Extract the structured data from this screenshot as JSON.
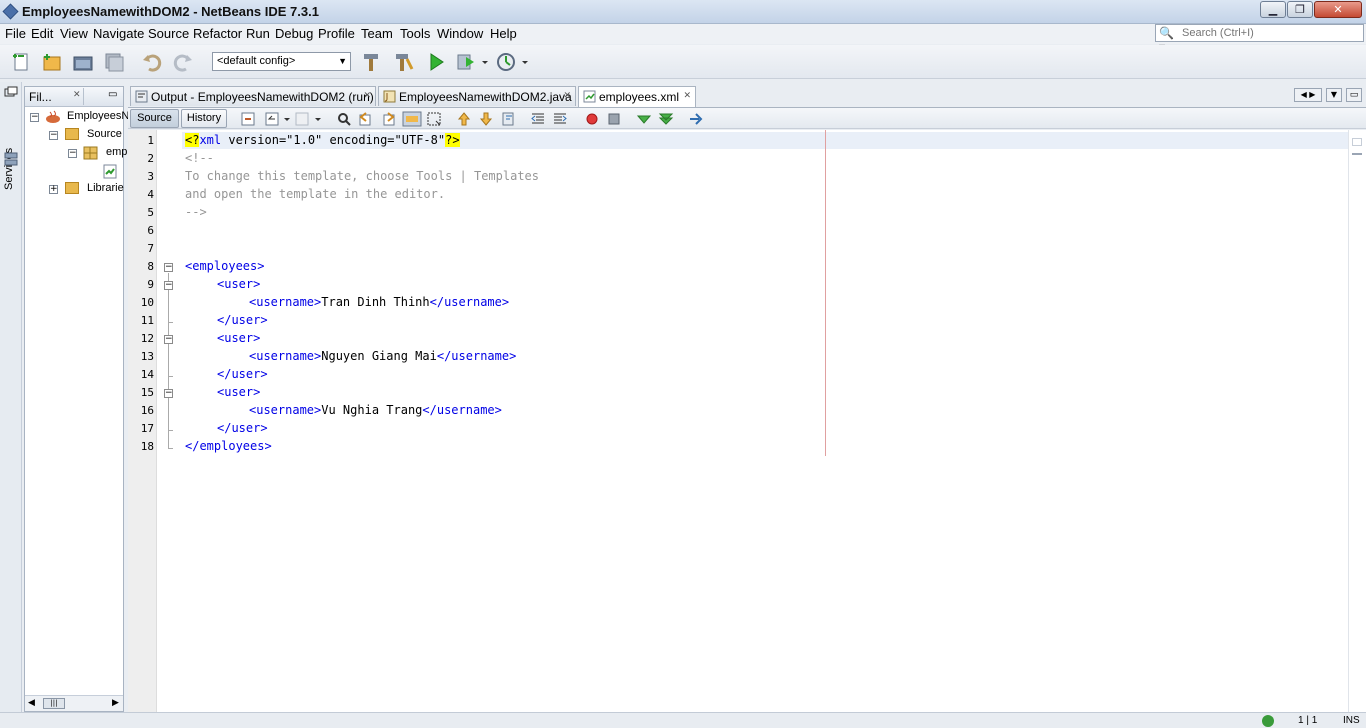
{
  "window": {
    "title": "EmployeesNamewithDOM2 - NetBeans IDE 7.3.1",
    "min_label": "▁",
    "max_label": "❐",
    "close_label": "✕"
  },
  "menubar": {
    "items": [
      "File",
      "Edit",
      "View",
      "Navigate",
      "Source",
      "Refactor",
      "Run",
      "Debug",
      "Profile",
      "Team",
      "Tools",
      "Window",
      "Help"
    ]
  },
  "search": {
    "placeholder": "Search (Ctrl+I)"
  },
  "toolbar": {
    "config": "<default config>"
  },
  "side_strip": {
    "services_label": "Services"
  },
  "files_panel": {
    "title": "Fil...",
    "tree": [
      {
        "label": "EmployeesN",
        "level": 0
      },
      {
        "label": "Source",
        "level": 1
      },
      {
        "label": "emp",
        "level": 2
      },
      {
        "label": "Librarie",
        "level": 1
      }
    ]
  },
  "editor_tabs": [
    {
      "label": "Output - EmployeesNamewithDOM2 (run)",
      "active": false
    },
    {
      "label": "EmployeesNamewithDOM2.java",
      "active": false
    },
    {
      "label": "employees.xml",
      "active": true
    }
  ],
  "editor_toolbar": {
    "source_label": "Source",
    "history_label": "History"
  },
  "code": {
    "line_numbers": [
      "1",
      "2",
      "3",
      "4",
      "5",
      "6",
      "7",
      "8",
      "9",
      "10",
      "11",
      "12",
      "13",
      "14",
      "15",
      "16",
      "17",
      "18"
    ],
    "decl_open": "<?",
    "decl_name": "xml",
    "decl_attrs": " version=\"1.0\" encoding=\"UTF-8\"",
    "decl_close": "?>",
    "comment_open": "<!--",
    "comment_line1": "To change this template, choose Tools | Templates",
    "comment_line2": "and open the template in the editor.",
    "comment_close": "-->",
    "employees_open": "<employees>",
    "employees_close": "</employees>",
    "user_open": "<user>",
    "user_close": "</user>",
    "username_open": "<username>",
    "username_close": "</username>",
    "usernames": [
      "Tran Dinh Thinh",
      "Nguyen Giang Mai",
      "Vu Nghia Trang"
    ]
  },
  "statusbar": {
    "position": "1 | 1",
    "mode": "INS"
  }
}
